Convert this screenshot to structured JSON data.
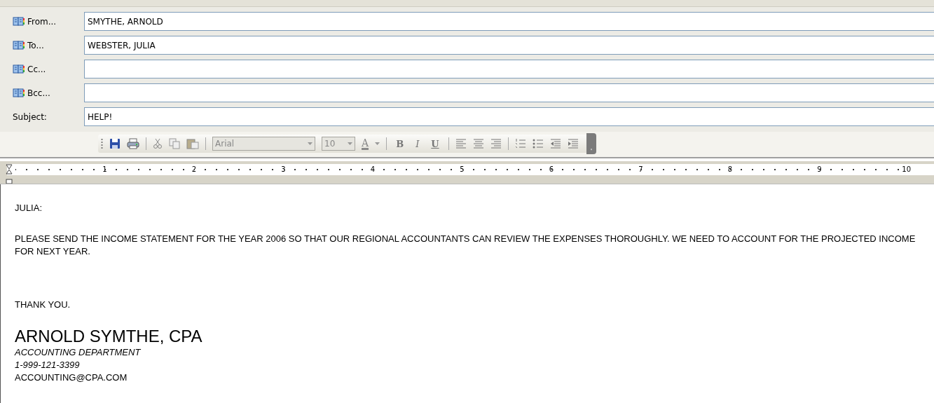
{
  "header_fields": [
    {
      "kind": "address",
      "label": "From...",
      "value": "SMYTHE, ARNOLD"
    },
    {
      "kind": "address",
      "label": "To...",
      "value": "WEBSTER, JULIA"
    },
    {
      "kind": "address",
      "label": "Cc..."
    },
    {
      "kind": "address",
      "label": "Bcc..."
    },
    {
      "kind": "plain",
      "label": "Subject:",
      "value": "HELP!"
    }
  ],
  "toolbar": {
    "font_name": "Arial",
    "font_size": "10",
    "font_color_label": "A",
    "format_buttons": [
      {
        "kind": "bold",
        "label": "B"
      },
      {
        "kind": "italic",
        "label": "I"
      },
      {
        "kind": "underline",
        "label": "U"
      }
    ]
  },
  "ruler": {
    "numbers": [
      "1",
      "2",
      "3",
      "4",
      "5",
      "6",
      "7",
      "8",
      "9",
      "10"
    ]
  },
  "message": {
    "greeting": "JULIA:",
    "paragraph": "PLEASE SEND THE INCOME STATEMENT FOR THE YEAR 2006 SO THAT OUR REGIONAL ACCOUNTANTS CAN REVIEW THE EXPENSES THOROUGHLY.  WE NEED TO ACCOUNT FOR THE PROJECTED INCOME FOR NEXT YEAR.",
    "closing": "THANK YOU.",
    "signature": {
      "name": "ARNOLD SYMTHE, CPA",
      "department": "ACCOUNTING DEPARTMENT",
      "phone": "1-999-121-3399",
      "email": "ACCOUNTING@CPA.COM"
    }
  }
}
